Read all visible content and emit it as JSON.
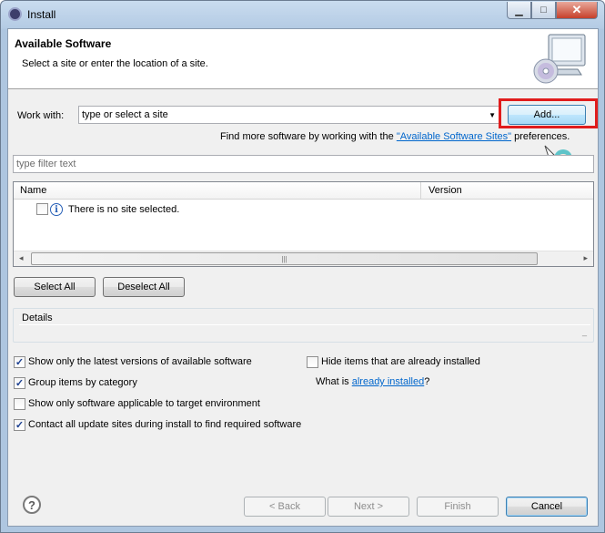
{
  "window": {
    "title": "Install",
    "minimize": "▁",
    "maximize": "□",
    "close": "✕"
  },
  "header": {
    "title": "Available Software",
    "description": "Select a site or enter the location of a site.",
    "image_icon": "computer-cd-icon"
  },
  "work_with": {
    "label": "Work with:",
    "value": "type or select a site",
    "dropdown_arrow": "▼",
    "add_button": "Add...",
    "find_more_prefix": "Find more software by working with the ",
    "find_more_link": "\"Available Software Sites\"",
    "find_more_suffix": " preferences."
  },
  "filter": {
    "placeholder": "type filter text"
  },
  "table": {
    "columns": [
      "Name",
      "Version"
    ],
    "message": "There is no site selected.",
    "info_icon": "i",
    "scroll_left": "◂",
    "scroll_right": "▸",
    "thumb_grip": "|||"
  },
  "buttons": {
    "select_all": "Select All",
    "deselect_all": "Deselect All"
  },
  "details": {
    "label": "Details",
    "marker": "_"
  },
  "options": {
    "latest_versions": {
      "label": "Show only the latest versions of available software",
      "checked": true
    },
    "hide_installed": {
      "label": "Hide items that are already installed",
      "checked": false
    },
    "group_by_category": {
      "label": "Group items by category",
      "checked": true
    },
    "what_is_prefix": "What is ",
    "what_is_link": "already installed",
    "what_is_suffix": "?",
    "target_env": {
      "label": "Show only software applicable to target environment",
      "checked": false
    },
    "contact_sites": {
      "label": "Contact all update sites during install to find required software",
      "checked": true
    },
    "check_mark": "✓"
  },
  "footer": {
    "help": "?",
    "back": "< Back",
    "next": "Next >",
    "finish": "Finish",
    "cancel": "Cancel"
  },
  "colors": {
    "highlight": "#e01c1c",
    "link": "#0066cc",
    "accent": "#3c7fb1"
  }
}
